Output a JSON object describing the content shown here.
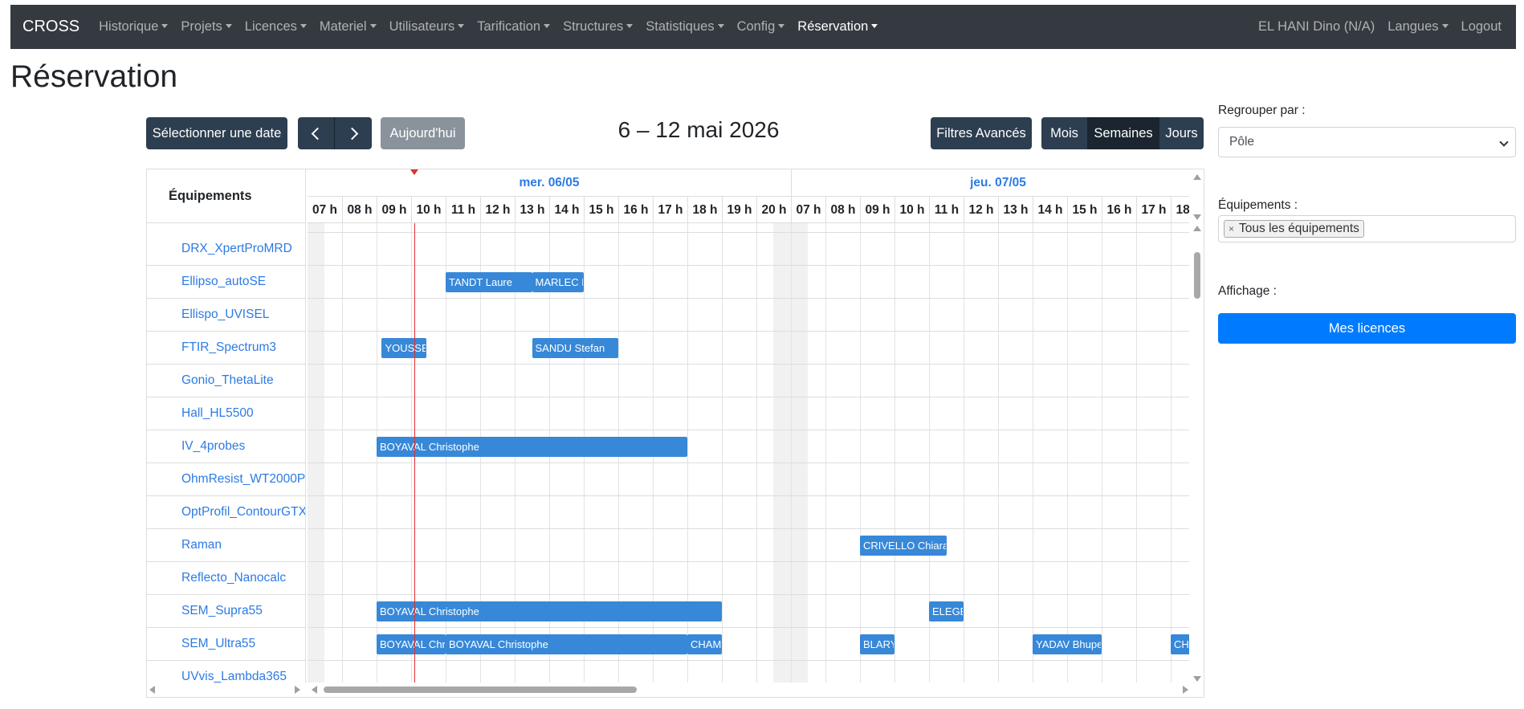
{
  "navbar": {
    "brand": "CROSS",
    "items": [
      {
        "label": "Historique",
        "name": "nav-historique"
      },
      {
        "label": "Projets",
        "name": "nav-projets"
      },
      {
        "label": "Licences",
        "name": "nav-licences"
      },
      {
        "label": "Materiel",
        "name": "nav-materiel"
      },
      {
        "label": "Utilisateurs",
        "name": "nav-utilisateurs"
      },
      {
        "label": "Tarification",
        "name": "nav-tarification"
      },
      {
        "label": "Structures",
        "name": "nav-structures"
      },
      {
        "label": "Statistiques",
        "name": "nav-statistiques"
      },
      {
        "label": "Config",
        "name": "nav-config"
      },
      {
        "label": "Réservation",
        "name": "nav-reservation",
        "active": true
      }
    ],
    "user": "EL HANI Dino (N/A)",
    "languages": "Langues",
    "logout": "Logout"
  },
  "page": {
    "title": "Réservation"
  },
  "toolbar": {
    "select_date": "Sélectionner une date",
    "today": "Aujourd'hui",
    "date_range": "6 – 12 mai 2026",
    "advanced_filters": "Filtres Avancés",
    "views": [
      {
        "label": "Mois",
        "active": false
      },
      {
        "label": "Semaines",
        "active": true
      },
      {
        "label": "Jours",
        "active": false
      }
    ]
  },
  "calendar": {
    "resource_header": "Équipements",
    "days": [
      {
        "label": "mer. 06/05",
        "hours": [
          "07 h",
          "08 h",
          "09 h",
          "10 h",
          "11 h",
          "12 h",
          "13 h",
          "14 h",
          "15 h",
          "16 h",
          "17 h",
          "18 h",
          "19 h",
          "20 h"
        ]
      },
      {
        "label": "jeu. 07/05",
        "hours": [
          "07 h",
          "08 h",
          "09 h",
          "10 h",
          "11 h",
          "12 h",
          "13 h",
          "14 h",
          "15 h",
          "16 h",
          "17 h",
          "18 h"
        ]
      }
    ],
    "now_hour": 10.1,
    "resources": [
      "DRX_XpertProMRD",
      "Ellipso_autoSE",
      "Ellispo_UVISEL",
      "FTIR_Spectrum3",
      "Gonio_ThetaLite",
      "Hall_HL5500",
      "IV_4probes",
      "OhmResist_WT2000PV",
      "OptProfil_ContourGTX",
      "Raman",
      "Reflecto_Nanocalc",
      "SEM_Supra55",
      "SEM_Ultra55",
      "UVvis_Lambda365"
    ],
    "events": [
      {
        "row": 1,
        "day": 0,
        "start": 11.0,
        "end": 13.5,
        "label": "TANDT Laure"
      },
      {
        "row": 1,
        "day": 0,
        "start": 13.5,
        "end": 15.0,
        "label": "MARLEC F"
      },
      {
        "row": 3,
        "day": 0,
        "start": 9.15,
        "end": 10.45,
        "label": "YOUSSEF"
      },
      {
        "row": 3,
        "day": 0,
        "start": 13.5,
        "end": 16.0,
        "label": "SANDU Stefan"
      },
      {
        "row": 6,
        "day": 0,
        "start": 9.0,
        "end": 18.0,
        "label": "BOYAVAL Christophe"
      },
      {
        "row": 9,
        "day": 1,
        "start": 9.0,
        "end": 11.5,
        "label": "CRIVELLO Chiara"
      },
      {
        "row": 11,
        "day": 0,
        "start": 9.0,
        "end": 19.0,
        "label": "BOYAVAL Christophe"
      },
      {
        "row": 11,
        "day": 1,
        "start": 11.0,
        "end": 12.0,
        "label": "ELEGB"
      },
      {
        "row": 12,
        "day": 0,
        "start": 9.0,
        "end": 11.0,
        "label": "BOYAVAL Chr"
      },
      {
        "row": 12,
        "day": 0,
        "start": 11.0,
        "end": 18.0,
        "label": "BOYAVAL Christophe"
      },
      {
        "row": 12,
        "day": 0,
        "start": 18.0,
        "end": 19.0,
        "label": "CHAM"
      },
      {
        "row": 12,
        "day": 1,
        "start": 9.0,
        "end": 10.0,
        "label": "BLARY"
      },
      {
        "row": 12,
        "day": 1,
        "start": 14.0,
        "end": 16.0,
        "label": "YADAV Bhupe"
      },
      {
        "row": 12,
        "day": 1,
        "start": 18.0,
        "end": 19.0,
        "label": "CHA"
      }
    ]
  },
  "sidebar": {
    "group_label": "Regrouper par :",
    "group_value": "Pôle",
    "equip_label": "Équipements :",
    "equip_tag": "Tous les équipements",
    "display_label": "Affichage :",
    "licences_button": "Mes licences"
  }
}
